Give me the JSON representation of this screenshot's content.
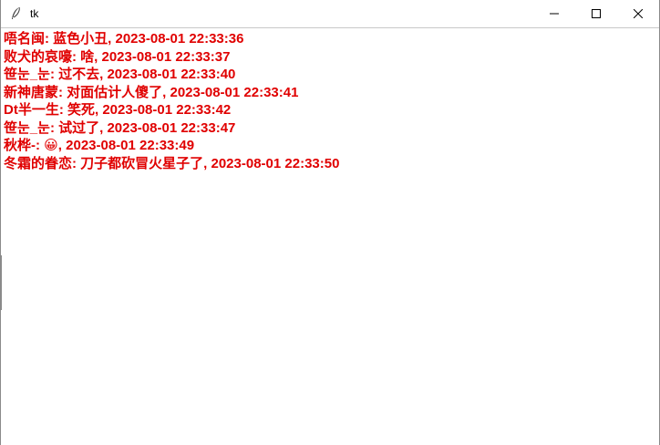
{
  "window": {
    "title": "tk"
  },
  "colors": {
    "message_text": "#e00000",
    "background": "#ffffff"
  },
  "messages": [
    "唔名闽: 蓝色小丑, 2023-08-01 22:33:36",
    "败犬的哀嚎: 啥, 2023-08-01 22:33:37",
    "笹눈_눈: 过不去, 2023-08-01 22:33:40",
    "新神唐蒙: 对面估计人傻了, 2023-08-01 22:33:41",
    "Dt半一生: 笑死, 2023-08-01 22:33:42",
    "笹눈_눈: 试过了, 2023-08-01 22:33:47",
    "秋桦-: 😀, 2023-08-01 22:33:49",
    "冬霜的眷恋: 刀子都砍冒火星子了, 2023-08-01 22:33:50"
  ],
  "icons": {
    "app": "feather-icon",
    "minimize": "minimize-icon",
    "maximize": "maximize-icon",
    "close": "close-icon"
  }
}
